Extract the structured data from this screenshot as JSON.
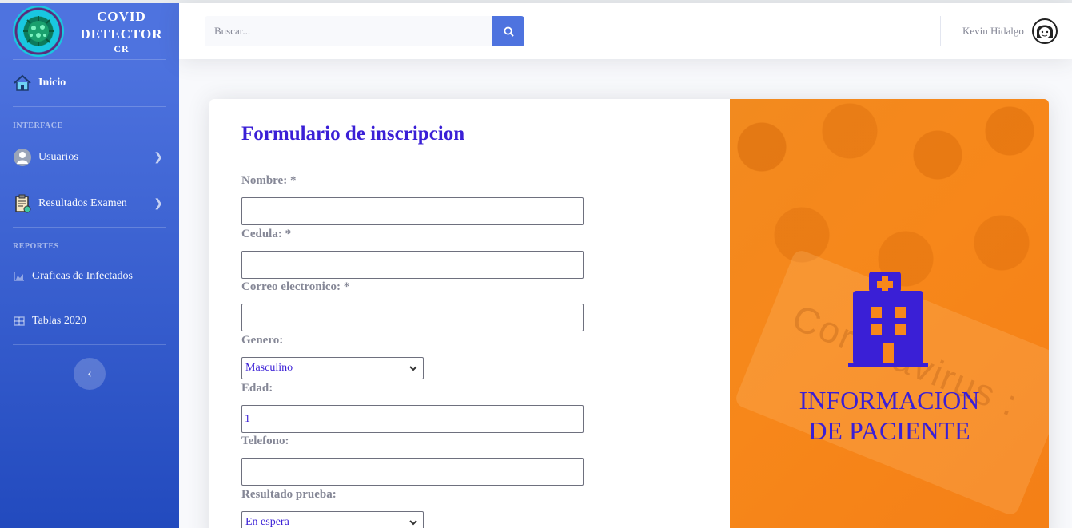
{
  "brand": {
    "line1": "COVID",
    "line2": "DETECTOR",
    "line3": "CR"
  },
  "sidebar": {
    "home": "Inicio",
    "heading_interface": "INTERFACE",
    "items_interface": [
      {
        "label": "Usuarios",
        "icon": "user-icon"
      },
      {
        "label": "Resultados Examen",
        "icon": "clipboard-icon"
      }
    ],
    "heading_reportes": "REPORTES",
    "items_reportes": [
      {
        "label": "Graficas de Infectados",
        "icon": "area-chart-icon"
      },
      {
        "label": "Tablas 2020",
        "icon": "table-icon"
      }
    ]
  },
  "topbar": {
    "search_placeholder": "Buscar...",
    "user_name": "Kevin Hidalgo"
  },
  "form": {
    "title": "Formulario de inscripcion",
    "fields": {
      "nombre": {
        "label": "Nombre: *",
        "value": ""
      },
      "cedula": {
        "label": "Cedula: *",
        "value": ""
      },
      "correo": {
        "label": "Correo electronico: *",
        "value": ""
      },
      "genero": {
        "label": "Genero:",
        "selected": "Masculino"
      },
      "edad": {
        "label": "Edad:",
        "value": "1"
      },
      "telefono": {
        "label": "Telefono:",
        "value": ""
      },
      "resultado": {
        "label": "Resultado prueba:",
        "selected": "En espera"
      }
    }
  },
  "panel": {
    "title_line1": "INFORMACION",
    "title_line2": "DE PACIENTE",
    "background_text": "Coronavirus :",
    "colors": {
      "accent": "#3a1fd6",
      "panel_bg": "#f7871a",
      "sidebar": "#4e73df"
    }
  }
}
